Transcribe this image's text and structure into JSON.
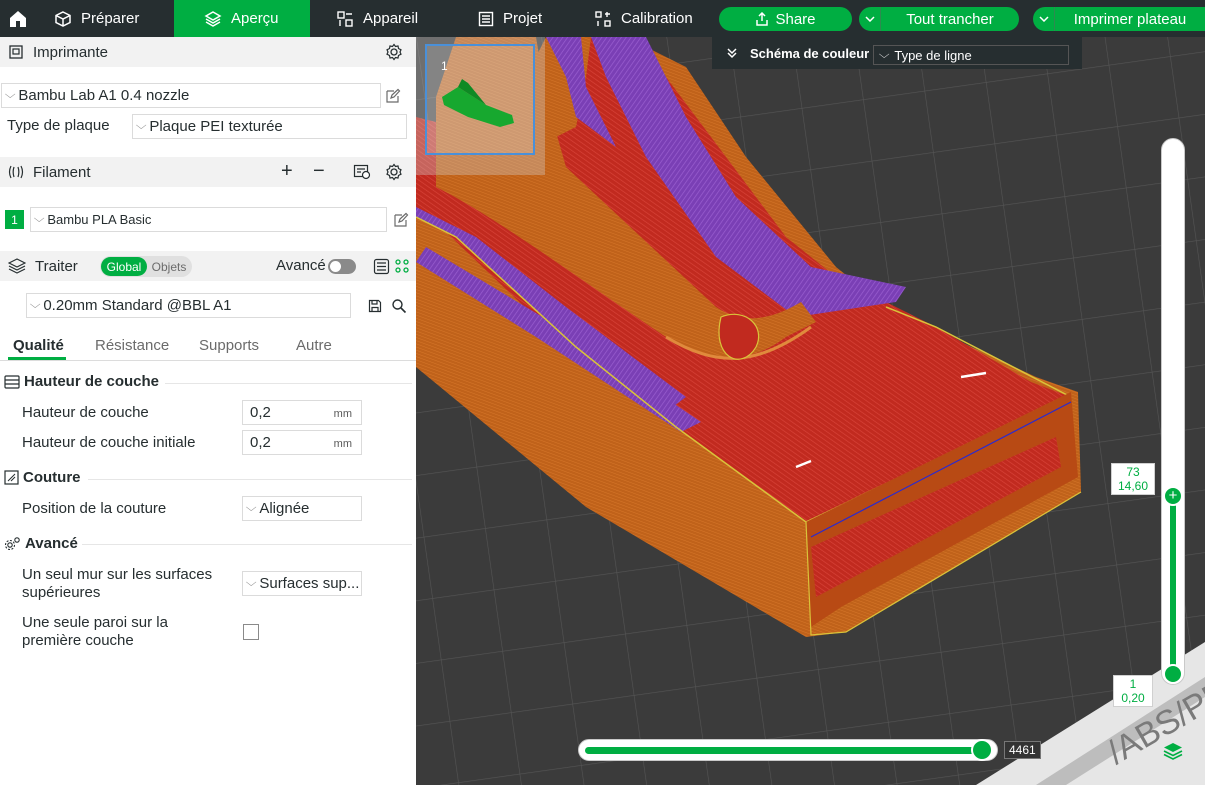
{
  "topbar": {
    "tabs": [
      {
        "label": "Préparer"
      },
      {
        "label": "Aperçu"
      },
      {
        "label": "Appareil"
      },
      {
        "label": "Projet"
      },
      {
        "label": "Calibration"
      }
    ],
    "share_label": "Share",
    "slice_label": "Tout trancher",
    "print_label": "Imprimer plateau",
    "active_tab": "Aperçu",
    "accent_color": "#00ae42",
    "bar_color": "#262e30"
  },
  "printer": {
    "section_title": "Imprimante",
    "printer_name": "Bambu Lab A1 0.4 nozzle",
    "plate_label": "Type de plaque",
    "plate_value": "Plaque PEI texturée"
  },
  "filament": {
    "section_title": "Filament",
    "slot_number": "1",
    "filament_name": "Bambu PLA Basic"
  },
  "process": {
    "section_title": "Traiter",
    "toggle_global": "Global",
    "toggle_objects": "Objets",
    "advanced_label": "Avancé",
    "preset": "0.20mm Standard @BBL A1",
    "tabs": [
      "Qualité",
      "Résistance",
      "Supports",
      "Autre"
    ],
    "active_tab": "Qualité"
  },
  "groups": {
    "layer_height": {
      "title": "Hauteur de couche",
      "layer_height_label": "Hauteur de couche",
      "layer_height_value": "0,2",
      "initial_layer_label": "Hauteur de couche initiale",
      "initial_layer_value": "0,2",
      "unit": "mm"
    },
    "seam": {
      "title": "Couture",
      "position_label": "Position de la couture",
      "position_value": "Alignée"
    },
    "advanced": {
      "title": "Avancé",
      "top_wall_label": "Un seul mur sur les surfaces supérieures",
      "top_wall_value": "Surfaces sup...",
      "first_layer_label": "Une seule paroi sur la première couche",
      "first_layer_checked": false
    }
  },
  "viewport": {
    "plate_thumb_number": "1",
    "color_scheme_label": "Schéma de couleur",
    "color_scheme_value": "Type de ligne",
    "layer_top_number": "73",
    "layer_top_height": "14,60",
    "layer_bottom_number": "1",
    "layer_bottom_height": "0,20",
    "move_value": "4461",
    "bed_text": "/ABS/PE",
    "layer_fraction_top": 1.0,
    "move_fraction": 1.0
  }
}
